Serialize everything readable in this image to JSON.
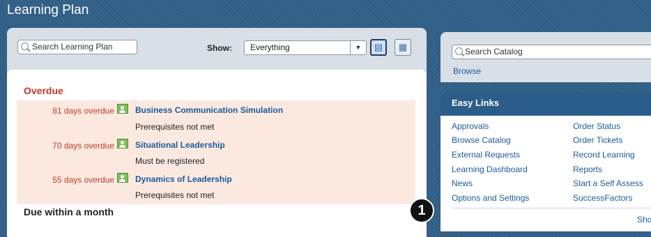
{
  "app": {
    "title": "Learning Plan"
  },
  "plan_toolbar": {
    "search_placeholder": "Search Learning Plan",
    "show_label": "Show:",
    "show_value": "Everything",
    "list_view_icon": "list-view-icon",
    "tile_view_icon": "tile-view-icon"
  },
  "sections": {
    "overdue_title": "Overdue",
    "due_title": "Due within a month",
    "overdue_items": [
      {
        "days": "81 days overdue",
        "title": "Business Communication Simulation",
        "status": "Prerequisites not met"
      },
      {
        "days": "70 days overdue",
        "title": "Situational Leadership",
        "status": "Must be registered"
      },
      {
        "days": "55 days overdue",
        "title": "Dynamics of Leadership",
        "status": "Prerequisites not met"
      }
    ]
  },
  "catalog": {
    "search_placeholder": "Search Catalog",
    "browse": "Browse"
  },
  "easy_links": {
    "title": "Easy Links",
    "left": [
      "Approvals",
      "Browse Catalog",
      "External Requests",
      "Learning Dashboard",
      "News",
      "Options and Settings"
    ],
    "right": [
      "Order Status",
      "Order Tickets",
      "Record Learning",
      "Reports",
      "Start a Self Assess",
      "SuccessFactors"
    ],
    "more": "Sho"
  },
  "callout": {
    "number": "1"
  },
  "colors": {
    "overdue": "#c0392b",
    "link": "#1a5a99",
    "header": "#2a5d8a"
  }
}
